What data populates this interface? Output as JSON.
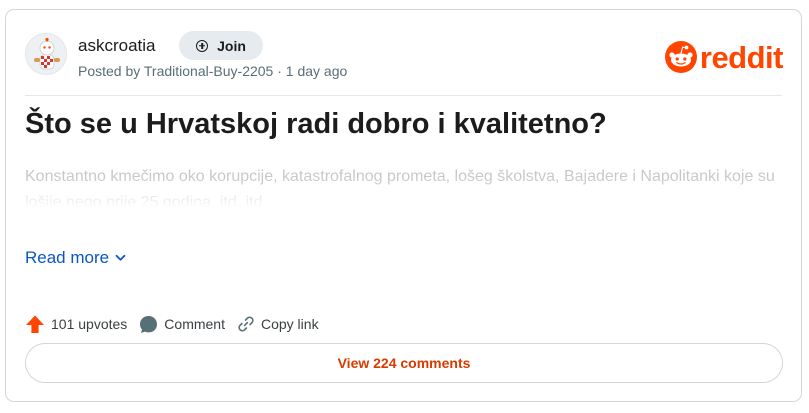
{
  "post": {
    "subreddit": "askcroatia",
    "join_label": "Join",
    "meta": "Posted by Traditional-Buy-2205 · 1 day ago",
    "title": "Što se u Hrvatskoj radi dobro i kvalitetno?",
    "body": "Konstantno kmečimo oko korupcije, katastrofalnog prometa, lošeg školstva, Bajadere i Napolitanki koje su lošije nego prije 25 godina, itd, itd.",
    "read_more": "Read more"
  },
  "brand": {
    "wordmark": "reddit",
    "color": "#ff4500"
  },
  "actions": {
    "upvotes": "101 upvotes",
    "comment": "Comment",
    "copy_link": "Copy link",
    "view_comments": "View 224 comments"
  },
  "icons": [
    "subreddit-avatar-icon",
    "plus-circle-icon",
    "reddit-logo-icon",
    "chevron-down-icon",
    "upvote-arrow-icon",
    "comment-bubble-icon",
    "link-icon"
  ]
}
